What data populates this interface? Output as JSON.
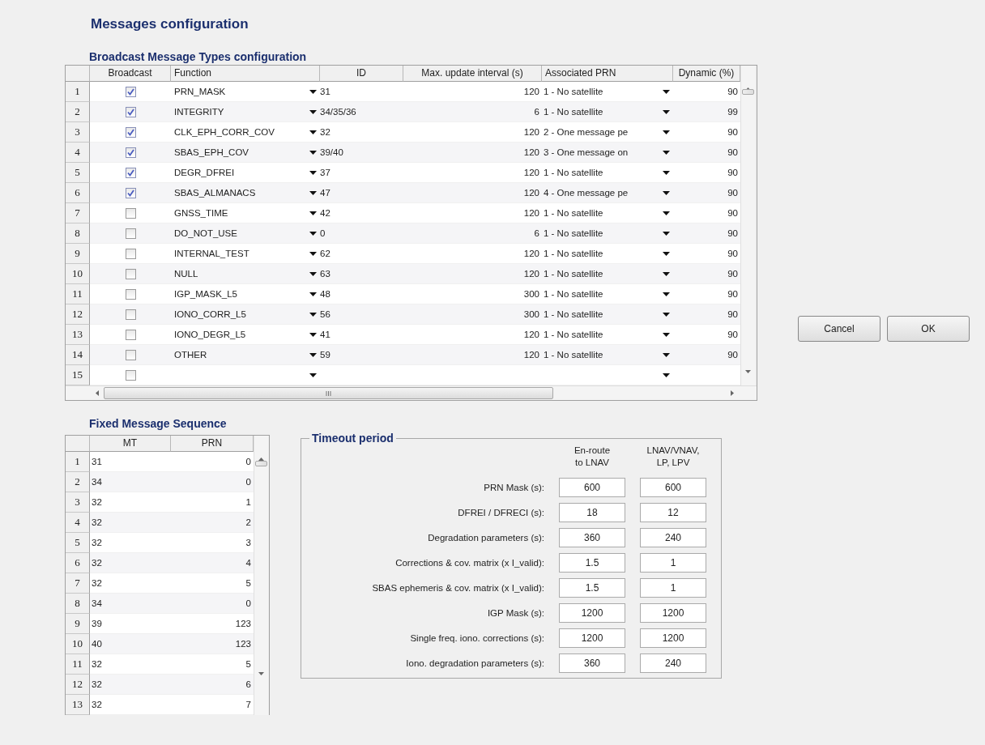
{
  "title": "Messages configuration",
  "broadcast_table": {
    "heading": "Broadcast Message Types configuration",
    "columns": [
      "Broadcast",
      "Function",
      "ID",
      "Max. update interval (s)",
      "Associated PRN",
      "Dynamic (%)"
    ],
    "rows": [
      {
        "number": "1",
        "broadcast": true,
        "function": "PRN_MASK",
        "id": "31",
        "max_interval": "120",
        "associated_prn": "1 - No satellite",
        "dynamic": "90"
      },
      {
        "number": "2",
        "broadcast": true,
        "function": "INTEGRITY",
        "id": "34/35/36",
        "max_interval": "6",
        "associated_prn": "1 - No satellite",
        "dynamic": "99"
      },
      {
        "number": "3",
        "broadcast": true,
        "function": "CLK_EPH_CORR_COV",
        "id": "32",
        "max_interval": "120",
        "associated_prn": "2 - One message pe",
        "dynamic": "90"
      },
      {
        "number": "4",
        "broadcast": true,
        "function": "SBAS_EPH_COV",
        "id": "39/40",
        "max_interval": "120",
        "associated_prn": "3 - One message on",
        "dynamic": "90"
      },
      {
        "number": "5",
        "broadcast": true,
        "function": "DEGR_DFREI",
        "id": "37",
        "max_interval": "120",
        "associated_prn": "1 - No satellite",
        "dynamic": "90"
      },
      {
        "number": "6",
        "broadcast": true,
        "function": "SBAS_ALMANACS",
        "id": "47",
        "max_interval": "120",
        "associated_prn": "4 - One message pe",
        "dynamic": "90"
      },
      {
        "number": "7",
        "broadcast": false,
        "function": "GNSS_TIME",
        "id": "42",
        "max_interval": "120",
        "associated_prn": "1 - No satellite",
        "dynamic": "90"
      },
      {
        "number": "8",
        "broadcast": false,
        "function": "DO_NOT_USE",
        "id": "0",
        "max_interval": "6",
        "associated_prn": "1 - No satellite",
        "dynamic": "90"
      },
      {
        "number": "9",
        "broadcast": false,
        "function": "INTERNAL_TEST",
        "id": "62",
        "max_interval": "120",
        "associated_prn": "1 - No satellite",
        "dynamic": "90"
      },
      {
        "number": "10",
        "broadcast": false,
        "function": "NULL",
        "id": "63",
        "max_interval": "120",
        "associated_prn": "1 - No satellite",
        "dynamic": "90"
      },
      {
        "number": "11",
        "broadcast": false,
        "function": "IGP_MASK_L5",
        "id": "48",
        "max_interval": "300",
        "associated_prn": "1 - No satellite",
        "dynamic": "90"
      },
      {
        "number": "12",
        "broadcast": false,
        "function": "IONO_CORR_L5",
        "id": "56",
        "max_interval": "300",
        "associated_prn": "1 - No satellite",
        "dynamic": "90"
      },
      {
        "number": "13",
        "broadcast": false,
        "function": "IONO_DEGR_L5",
        "id": "41",
        "max_interval": "120",
        "associated_prn": "1 - No satellite",
        "dynamic": "90"
      },
      {
        "number": "14",
        "broadcast": false,
        "function": "OTHER",
        "id": "59",
        "max_interval": "120",
        "associated_prn": "1 - No satellite",
        "dynamic": "90"
      },
      {
        "number": "15",
        "broadcast": false
      }
    ]
  },
  "fixed_sequence": {
    "heading": "Fixed Message Sequence",
    "columns": [
      "MT",
      "PRN"
    ],
    "rows": [
      {
        "number": "1",
        "mt": "31",
        "prn": "0"
      },
      {
        "number": "2",
        "mt": "34",
        "prn": "0"
      },
      {
        "number": "3",
        "mt": "32",
        "prn": "1"
      },
      {
        "number": "4",
        "mt": "32",
        "prn": "2"
      },
      {
        "number": "5",
        "mt": "32",
        "prn": "3"
      },
      {
        "number": "6",
        "mt": "32",
        "prn": "4"
      },
      {
        "number": "7",
        "mt": "32",
        "prn": "5"
      },
      {
        "number": "8",
        "mt": "34",
        "prn": "0"
      },
      {
        "number": "9",
        "mt": "39",
        "prn": "123"
      },
      {
        "number": "10",
        "mt": "40",
        "prn": "123"
      },
      {
        "number": "11",
        "mt": "32",
        "prn": "5"
      },
      {
        "number": "12",
        "mt": "32",
        "prn": "6"
      },
      {
        "number": "13",
        "mt": "32",
        "prn": "7"
      }
    ]
  },
  "timeout_period": {
    "legend": "Timeout period",
    "columns": [
      "En-route\nto LNAV",
      "LNAV/VNAV,\nLP, LPV"
    ],
    "rows": [
      {
        "label": "PRN Mask (s):",
        "en_route": "600",
        "lnav_vnav": "600"
      },
      {
        "label": "DFREI / DFRECI (s):",
        "en_route": "18",
        "lnav_vnav": "12"
      },
      {
        "label": "Degradation parameters (s):",
        "en_route": "360",
        "lnav_vnav": "240"
      },
      {
        "label": "Corrections & cov. matrix (x I_valid):",
        "en_route": "1.5",
        "lnav_vnav": "1"
      },
      {
        "label": "SBAS ephemeris & cov. matrix (x I_valid):",
        "en_route": "1.5",
        "lnav_vnav": "1"
      },
      {
        "label": "IGP Mask (s):",
        "en_route": "1200",
        "lnav_vnav": "1200"
      },
      {
        "label": "Single freq. iono. corrections (s):",
        "en_route": "1200",
        "lnav_vnav": "1200"
      },
      {
        "label": "Iono. degradation parameters (s):",
        "en_route": "360",
        "lnav_vnav": "240"
      }
    ]
  },
  "buttons": [
    {
      "label": "Cancel"
    },
    {
      "label": "OK"
    }
  ]
}
